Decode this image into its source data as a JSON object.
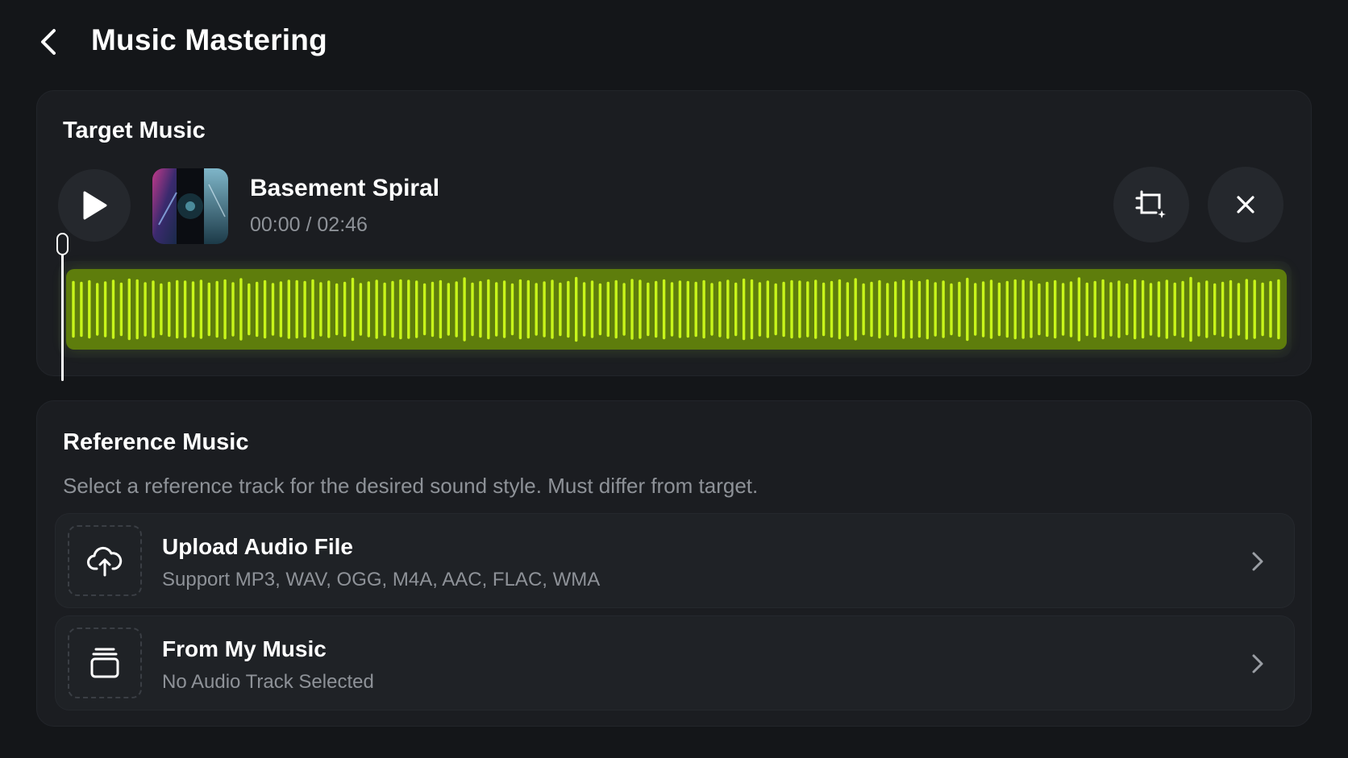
{
  "header": {
    "title": "Music Mastering",
    "back_icon": "chevron-left-icon"
  },
  "target": {
    "title": "Target Music",
    "track": {
      "name": "Basement Spiral",
      "time": "00:00 / 02:46",
      "progress": 0
    },
    "actions": [
      "crop-icon",
      "close-icon"
    ],
    "waveform_color": "#c8f51a"
  },
  "reference": {
    "title": "Reference Music",
    "description": "Select a reference track for the desired sound style. Must differ from target.",
    "options": [
      {
        "title": "Upload Audio File",
        "subtitle": "Support MP3, WAV, OGG, M4A, AAC, FLAC, WMA",
        "icon": "cloud-upload-icon"
      },
      {
        "title": "From My Music",
        "subtitle": "No Audio Track Selected",
        "icon": "music-library-icon"
      }
    ]
  },
  "colors": {
    "background": "#141619",
    "card": "#1b1d21",
    "accent": "#c8f51a",
    "muted_text": "#8e9298"
  }
}
